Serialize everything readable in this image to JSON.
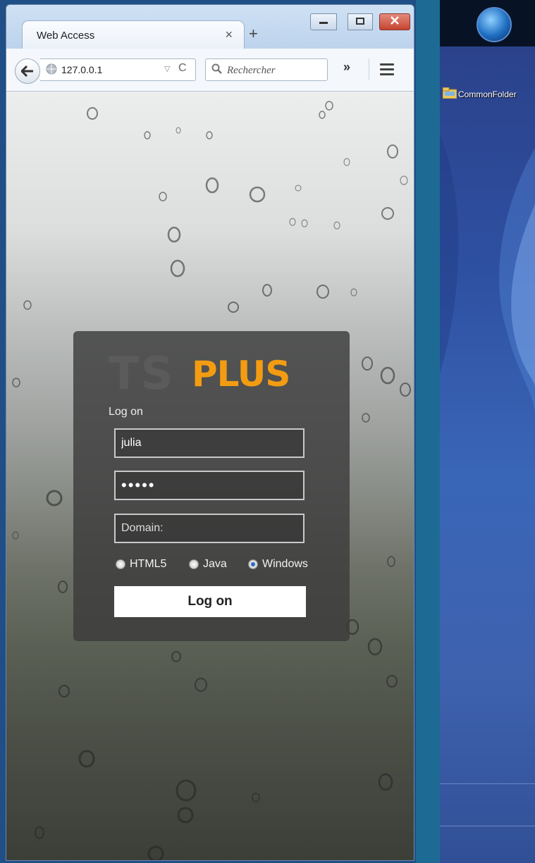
{
  "browser": {
    "tab_title": "Web Access",
    "new_tab_symbol": "+",
    "close_symbol": "×",
    "url": "127.0.0.1",
    "search_placeholder": "Rechercher",
    "overflow_symbol": "»"
  },
  "login": {
    "logo_ts": "TS",
    "logo_plus": "PLUS",
    "heading": "Log on",
    "username": "julia",
    "password": "•••••",
    "domain_placeholder": "Domain:",
    "options": [
      {
        "label": "HTML5",
        "selected": false
      },
      {
        "label": "Java",
        "selected": false
      },
      {
        "label": "Windows",
        "selected": true
      }
    ],
    "submit_label": "Log on"
  },
  "desktop": {
    "folder_label": "CommonFolder"
  },
  "colors": {
    "logo_accent": "#f39c12",
    "desktop_blue": "#3a66b8",
    "card_background": "#3c3c3c"
  }
}
